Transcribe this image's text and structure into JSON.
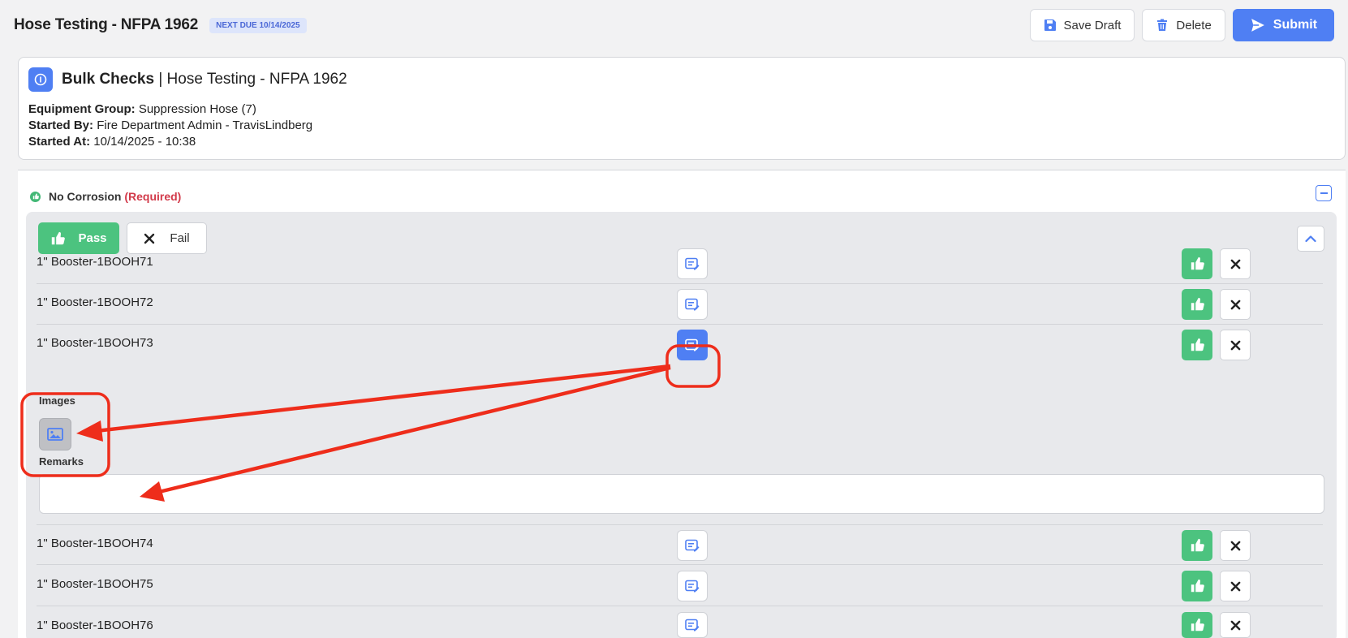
{
  "header": {
    "title": "Hose Testing - NFPA 1962",
    "due_badge": "NEXT DUE 10/14/2025",
    "save_draft_label": "Save Draft",
    "delete_label": "Delete",
    "submit_label": "Submit"
  },
  "panel": {
    "title_bold": "Bulk Checks",
    "title_rest": " | Hose Testing - NFPA 1962",
    "equipment_group_label": "Equipment Group:",
    "equipment_group_value": " Suppression Hose (7)",
    "started_by_label": "Started By:",
    "started_by_value": " Fire Department Admin - TravisLindberg",
    "started_at_label": "Started At:",
    "started_at_value": " 10/14/2025 - 10:38"
  },
  "check": {
    "name": "No Corrosion",
    "required": "(Required)",
    "pass_label": "Pass",
    "fail_label": "Fail",
    "images_label": "Images",
    "remarks_label": "Remarks",
    "remarks_value": "",
    "items": [
      {
        "name": "1\" Booster-1BOOH71"
      },
      {
        "name": "1\" Booster-1BOOH72"
      },
      {
        "name": "1\" Booster-1BOOH73"
      },
      {
        "name": "1\" Booster-1BOOH74"
      },
      {
        "name": "1\" Booster-1BOOH75"
      },
      {
        "name": "1\" Booster-1BOOH76"
      }
    ]
  },
  "colors": {
    "primary": "#4f7ff3",
    "pass": "#4cc37f",
    "required": "#d23a4a",
    "annotation": "#ee2d1b"
  },
  "icons": [
    "save-icon",
    "trash-icon",
    "send-icon",
    "info-icon",
    "thumbs-up-icon",
    "close-icon",
    "chevron-up-icon",
    "note-edit-icon",
    "image-icon",
    "minus-icon"
  ]
}
